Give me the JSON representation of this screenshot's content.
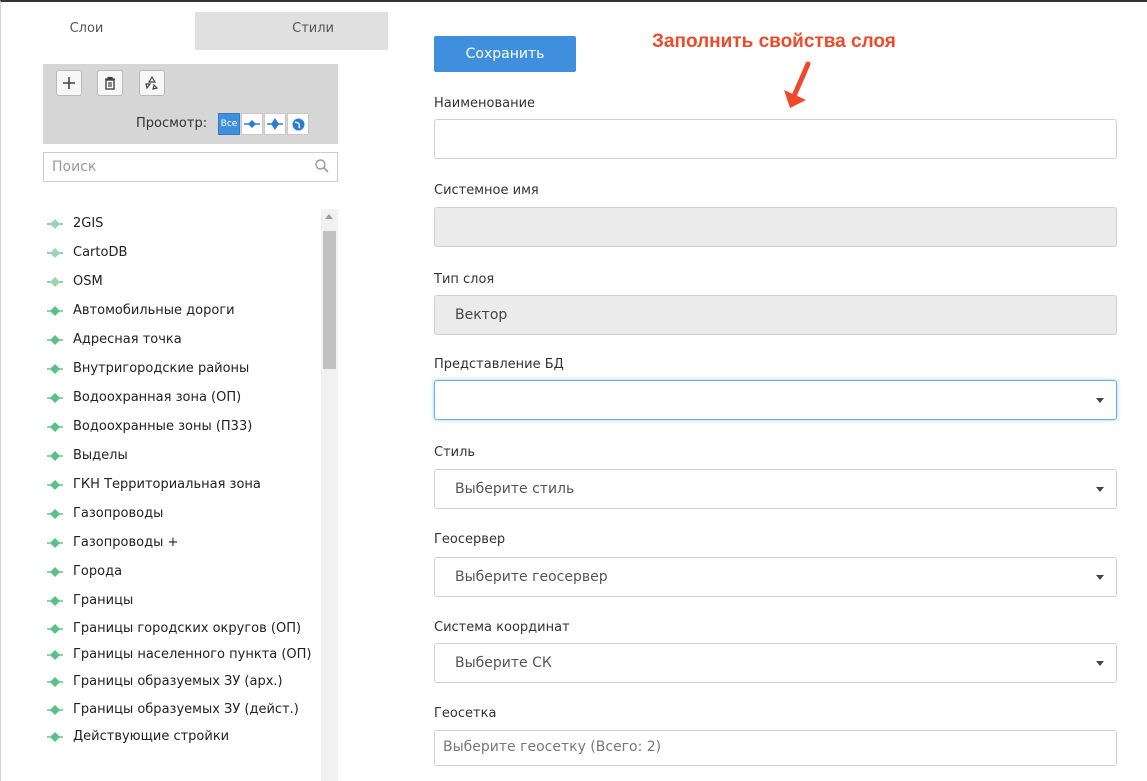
{
  "tabs": {
    "layers": "Слои",
    "styles": "Стили"
  },
  "toolbar": {
    "view_label": "Просмотр:",
    "view_all": "Все",
    "icons": [
      "plus-icon",
      "trash-icon",
      "recycle-icon"
    ],
    "view_icons": [
      "line-icon",
      "polygon-icon",
      "globe-icon"
    ]
  },
  "search": {
    "placeholder": "Поиск"
  },
  "layers": [
    {
      "name": "2GIS",
      "type": "remote"
    },
    {
      "name": "CartoDB",
      "type": "remote"
    },
    {
      "name": "OSM",
      "type": "remote"
    },
    {
      "name": "Автомобильные дороги",
      "type": "vector"
    },
    {
      "name": "Адресная точка",
      "type": "vector"
    },
    {
      "name": "Внутригородские районы",
      "type": "vector"
    },
    {
      "name": "Водоохранная зона (ОП)",
      "type": "vector"
    },
    {
      "name": "Водоохранные зоны (П33)",
      "type": "vector"
    },
    {
      "name": "Выделы",
      "type": "vector"
    },
    {
      "name": "ГКН Территориальная зона",
      "type": "vector"
    },
    {
      "name": "Газопроводы",
      "type": "vector"
    },
    {
      "name": "Газопроводы +",
      "type": "vector"
    },
    {
      "name": "Города",
      "type": "vector"
    },
    {
      "name": "Границы",
      "type": "vector"
    },
    {
      "name": "Границы городских округов (ОП)",
      "type": "vector"
    },
    {
      "name": "Границы населенного пункта (ОП)",
      "type": "vector"
    },
    {
      "name": "Границы образуемых ЗУ (арх.)",
      "type": "vector"
    },
    {
      "name": "Границы образуемых ЗУ (дейст.)",
      "type": "vector"
    },
    {
      "name": "Действующие стройки",
      "type": "vector"
    }
  ],
  "form": {
    "save_label": "Сохранить",
    "annotation": "Заполнить свойства слоя",
    "name_label": "Наименование",
    "name_value": "",
    "system_name_label": "Системное имя",
    "system_name_value": "",
    "layer_type_label": "Тип слоя",
    "layer_type_value": "Вектор",
    "db_view_label": "Представление БД",
    "db_view_value": "",
    "style_label": "Стиль",
    "style_value": "Выберите стиль",
    "geoserver_label": "Геосервер",
    "geoserver_value": "Выберите геосервер",
    "crs_label": "Система координат",
    "crs_value": "Выберите СК",
    "grid_label": "Геосетка",
    "grid_placeholder": "Выберите геосетку (Всего: 2)"
  },
  "colors": {
    "accent": "#3f8fdc",
    "annotation": "#ee4a2a",
    "layer_icon": "#5cbf8a"
  }
}
